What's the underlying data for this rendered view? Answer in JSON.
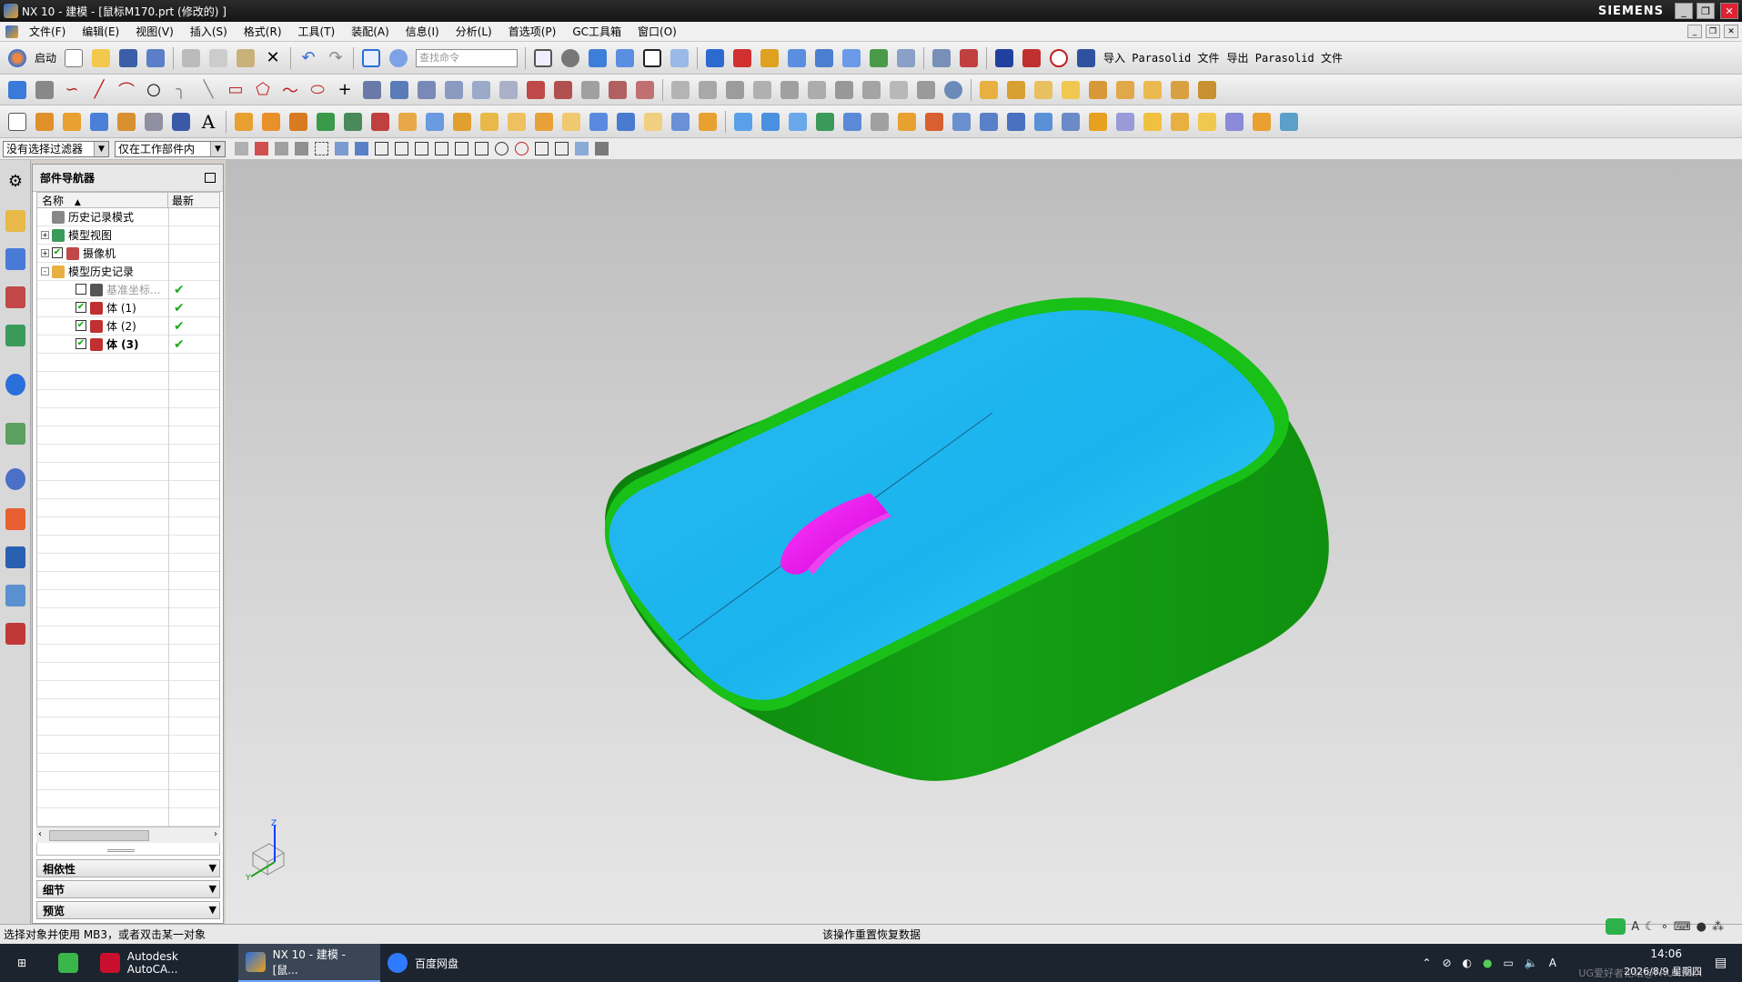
{
  "window": {
    "title": "NX 10 - 建模 - [鼠标M170.prt  (修改的) ]",
    "brand": "SIEMENS"
  },
  "menu": [
    "文件(F)",
    "编辑(E)",
    "视图(V)",
    "插入(S)",
    "格式(R)",
    "工具(T)",
    "装配(A)",
    "信息(I)",
    "分析(L)",
    "首选项(P)",
    "GC工具箱",
    "窗口(O)"
  ],
  "toolbar": {
    "start_label": "启动",
    "search_placeholder": "查找命令",
    "import_label": "导入 Parasolid 文件",
    "export_label": "导出 Parasolid 文件"
  },
  "filter": {
    "selection_filter": "没有选择过滤器",
    "scope": "仅在工作部件内"
  },
  "navigator": {
    "title": "部件导航器",
    "col_name": "名称",
    "col_latest": "最新",
    "rows": [
      {
        "label": "历史记录模式",
        "level": 0,
        "expander": "",
        "check": false,
        "latest": ""
      },
      {
        "label": "模型视图",
        "level": 0,
        "expander": "+",
        "check": false,
        "latest": ""
      },
      {
        "label": "摄像机",
        "level": 0,
        "expander": "+",
        "check": true,
        "latest": ""
      },
      {
        "label": "模型历史记录",
        "level": 0,
        "expander": "-",
        "check": false,
        "latest": ""
      },
      {
        "label": "基准坐标...",
        "level": 1,
        "expander": "",
        "check": false,
        "latest": "✔",
        "dim": true
      },
      {
        "label": "体 (1)",
        "level": 1,
        "expander": "",
        "check": true,
        "latest": "✔"
      },
      {
        "label": "体 (2)",
        "level": 1,
        "expander": "",
        "check": true,
        "latest": "✔"
      },
      {
        "label": "体 (3)",
        "level": 1,
        "expander": "",
        "check": true,
        "latest": "✔",
        "bold": true
      }
    ],
    "panels": [
      "相依性",
      "细节",
      "预览"
    ]
  },
  "status": {
    "left": "选择对象并使用 MB3，或者双击某一对象",
    "center": "该操作重置恢复数据"
  },
  "taskbar": {
    "items": [
      "Autodesk AutoCA...",
      "NX 10 - 建模 - [鼠...",
      "百度网盘"
    ],
    "time": "14:06",
    "date": "2026/8/9 星期四",
    "watermark": "UG爱好者论坛@FRUNSNX"
  },
  "triad": {
    "z": "Z",
    "y": "Y"
  }
}
